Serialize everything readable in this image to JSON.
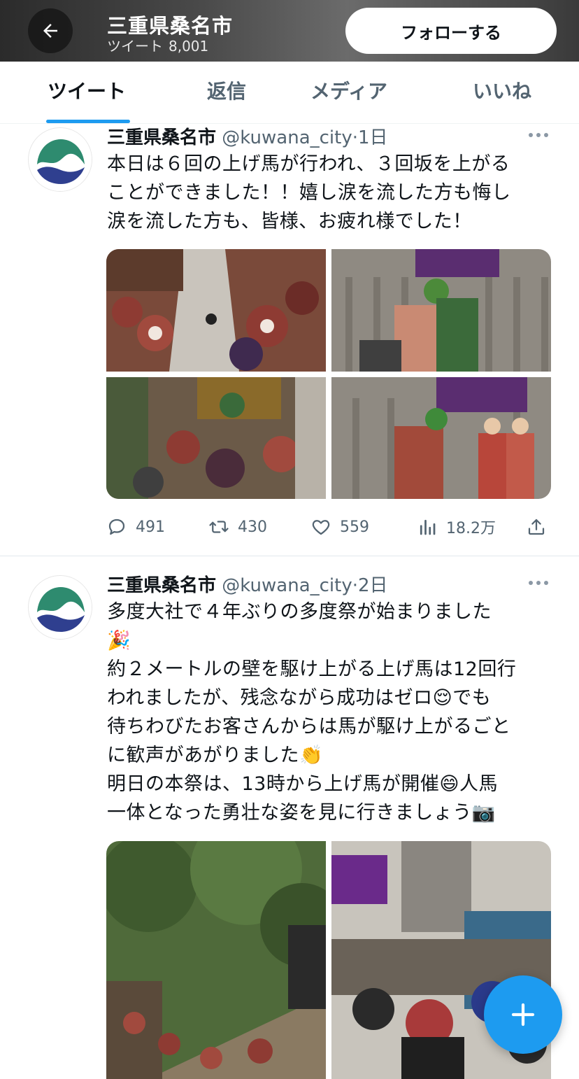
{
  "header": {
    "account_name": "三重県桑名市",
    "tweets_label": "ツイート",
    "tweets_count": "8,001",
    "follow_label": "フォローする"
  },
  "tabs": [
    {
      "label": "ツイート",
      "active": true
    },
    {
      "label": "返信",
      "active": false
    },
    {
      "label": "メディア",
      "active": false
    },
    {
      "label": "いいね",
      "active": false
    }
  ],
  "tweets": [
    {
      "name": "三重県桑名市",
      "handle": "@kuwana_city",
      "separator": "·",
      "time": "1日",
      "lines": [
        "本日は６回の上げ馬が行われ、３回坂を上がる",
        "ことができました！！嬉し涙を流した方も悔し",
        "涙を流した方も、皆様、お疲れ様でした！"
      ],
      "media_count": 4,
      "replies": "491",
      "retweets": "430",
      "likes": "559",
      "views": "18.2万"
    },
    {
      "name": "三重県桑名市",
      "handle": "@kuwana_city",
      "separator": "·",
      "time": "2日",
      "lines": [
        "多度大社で４年ぶりの多度祭が始まりました",
        "🎉",
        "約２メートルの壁を駆け上がる上げ馬は12回行",
        "われましたが、残念ながら成功はゼロ😌でも",
        "待ちわびたお客さんからは馬が駆け上がるごと",
        "に歓声があがりました👏",
        "明日の本祭は、13時から上げ馬が開催😄人馬",
        "一体となった勇壮な姿を見に行きましょう📷"
      ],
      "media_count": 2
    }
  ],
  "icons": {
    "back": "arrow-left-icon",
    "more": "more-horizontal-icon",
    "reply": "comment-icon",
    "retweet": "retweet-icon",
    "like": "heart-icon",
    "views": "bar-chart-icon",
    "share": "share-icon",
    "compose": "plus-icon"
  },
  "colors": {
    "accent": "#1d9bf0",
    "secondary_text": "#536471",
    "logo_green": "#2e8b6f",
    "logo_blue": "#2f3f8f"
  }
}
